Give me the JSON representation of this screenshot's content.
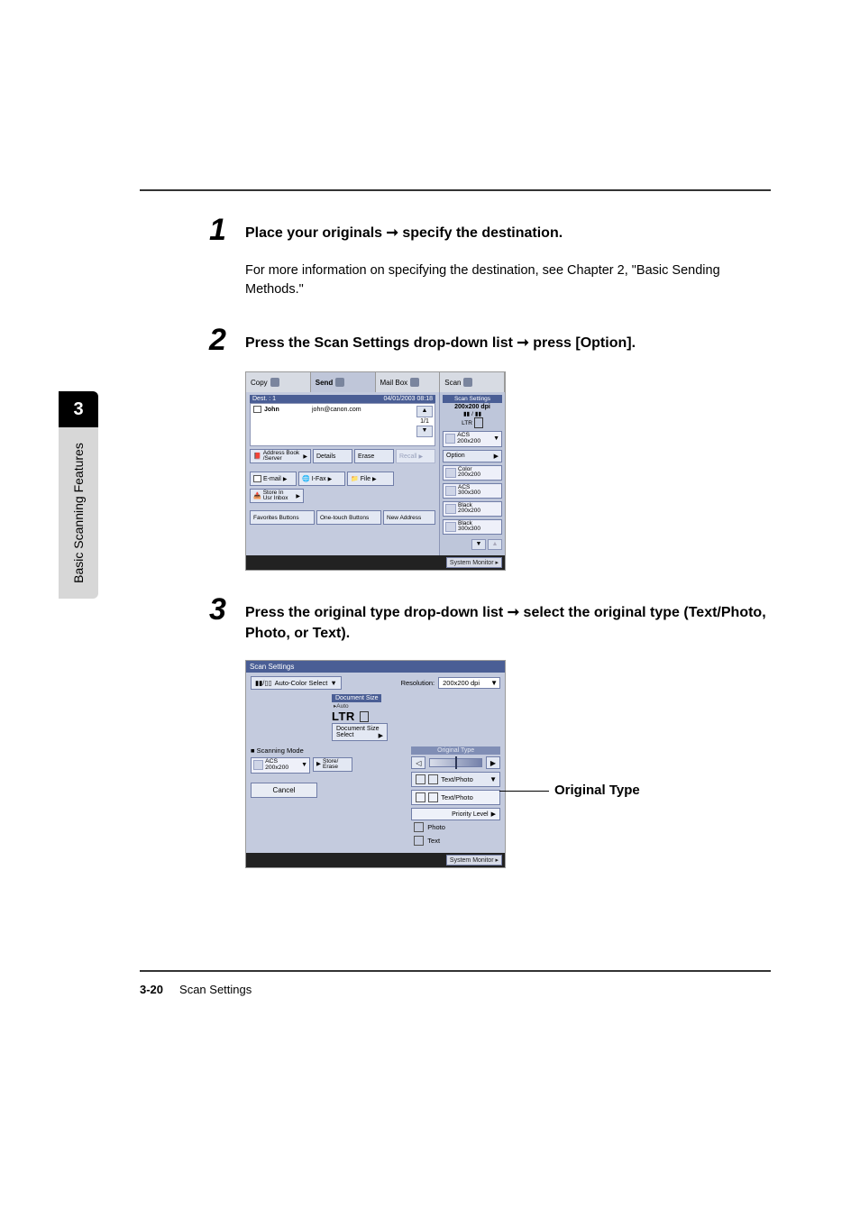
{
  "side": {
    "chapter": "3",
    "label": "Basic Scanning Features"
  },
  "step1": {
    "num": "1",
    "title_a": "Place your originals ",
    "title_b": " specify the destination.",
    "body": "For more information on specifying the destination, see Chapter 2, \"Basic Sending Methods.\""
  },
  "step2": {
    "num": "2",
    "title_a": "Press the Scan Settings drop-down list ",
    "title_b": " press [Option]."
  },
  "step3": {
    "num": "3",
    "title_a": "Press the original type drop-down list ",
    "title_b": " select the original type (Text/Photo, Photo, or Text)."
  },
  "ui1": {
    "tabs": {
      "copy": "Copy",
      "send": "Send",
      "mailbox": "Mail Box",
      "scan": "Scan"
    },
    "destbar": {
      "label": "Dest. :   1",
      "ts": "04/01/2003 08:18"
    },
    "dest_row": {
      "name": "John",
      "addr": "john@canon.com"
    },
    "pager": "1/1",
    "btns": {
      "addrbook": "Address Book /Server",
      "details": "Details",
      "erase": "Erase",
      "recall": "Recall",
      "email": "E-mail",
      "ifax": "I-Fax",
      "file": "File",
      "store": "Store In Usr Inbox",
      "fav": "Favorites Buttons",
      "onetouch": "One-touch Buttons",
      "newaddr": "New Address"
    },
    "ss": {
      "hdr": "Scan Settings",
      "res": "200x200 dpi",
      "size": "LTR",
      "mode": "ACS 200x200",
      "option": "Option",
      "presets": [
        {
          "l1": "Color",
          "l2": "200x200"
        },
        {
          "l1": "ACS",
          "l2": "300x300"
        },
        {
          "l1": "Black",
          "l2": "200x200"
        },
        {
          "l1": "Black",
          "l2": "300x300"
        }
      ]
    },
    "sysmon": "System Monitor"
  },
  "ui2": {
    "hdr": "Scan Settings",
    "acs": "Auto-Color Select",
    "res_lbl": "Resolution:",
    "res_val": "200x200 dpi",
    "docsize_lbl": "Document Size",
    "auto": "Auto",
    "ltr": "LTR",
    "dss": "Document Size Select",
    "scanmode_lbl": "Scanning Mode",
    "sm_acs": "ACS 200x200",
    "sm_store": "Store/ Erase",
    "orig_lbl": "Original Type",
    "tp": "Text/Photo",
    "tp2": "Text/Photo",
    "priority": "Priority Level",
    "photo": "Photo",
    "text": "Text",
    "cancel": "Cancel",
    "sysmon": "System Monitor"
  },
  "arrow": "➞",
  "callout": "Original Type",
  "footer": {
    "page": "3-20",
    "title": "Scan Settings"
  }
}
